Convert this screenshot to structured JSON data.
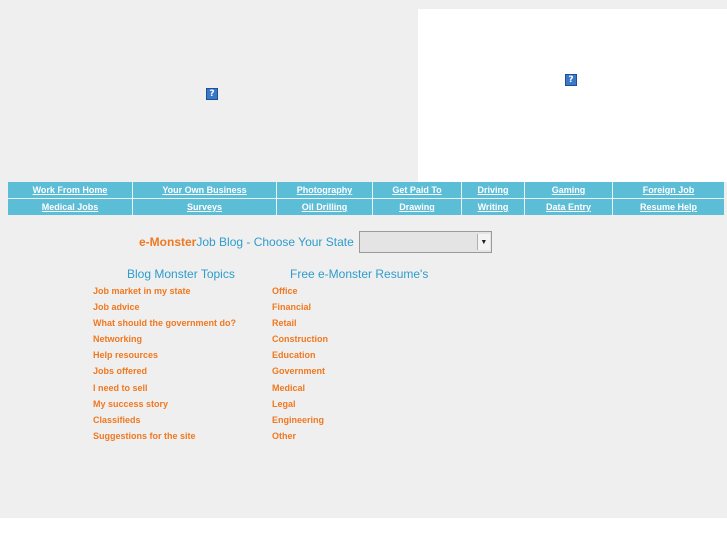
{
  "images": {
    "left_banner": "broken-image-icon",
    "right_banner": "broken-image-icon",
    "glyph": "?"
  },
  "nav": {
    "row1": [
      "Work From Home",
      "Your Own Business",
      "Photography",
      "Get Paid To",
      "Driving",
      "Gaming",
      "Foreign Job"
    ],
    "row2": [
      "Medical Jobs",
      "Surveys",
      "Oil Drilling",
      "Drawing",
      "Writing",
      "Data Entry",
      "Resume Help"
    ]
  },
  "state_chooser": {
    "brand": "e-Monster",
    "label": "Job Blog - Choose Your State",
    "selected": "",
    "arrow_icon": "chevron-down-icon"
  },
  "blog_topics": {
    "title": "Blog Monster Topics",
    "items": [
      "Job market in my state",
      "Job advice",
      "What should the government do?",
      "Networking",
      "Help resources",
      "Jobs offered",
      "I need to sell",
      "My success story",
      "Classifieds",
      "Suggestions for the site"
    ]
  },
  "resumes": {
    "title": "Free e-Monster Resume's",
    "items": [
      "Office",
      "Financial",
      "Retail",
      "Construction",
      "Education",
      "Government",
      "Medical",
      "Legal",
      "Engineering",
      "Other"
    ]
  },
  "colors": {
    "page_bg": "#efefef",
    "nav_bg": "#5bbdd6",
    "accent_orange": "#f07820",
    "accent_blue": "#2e9ccc"
  }
}
